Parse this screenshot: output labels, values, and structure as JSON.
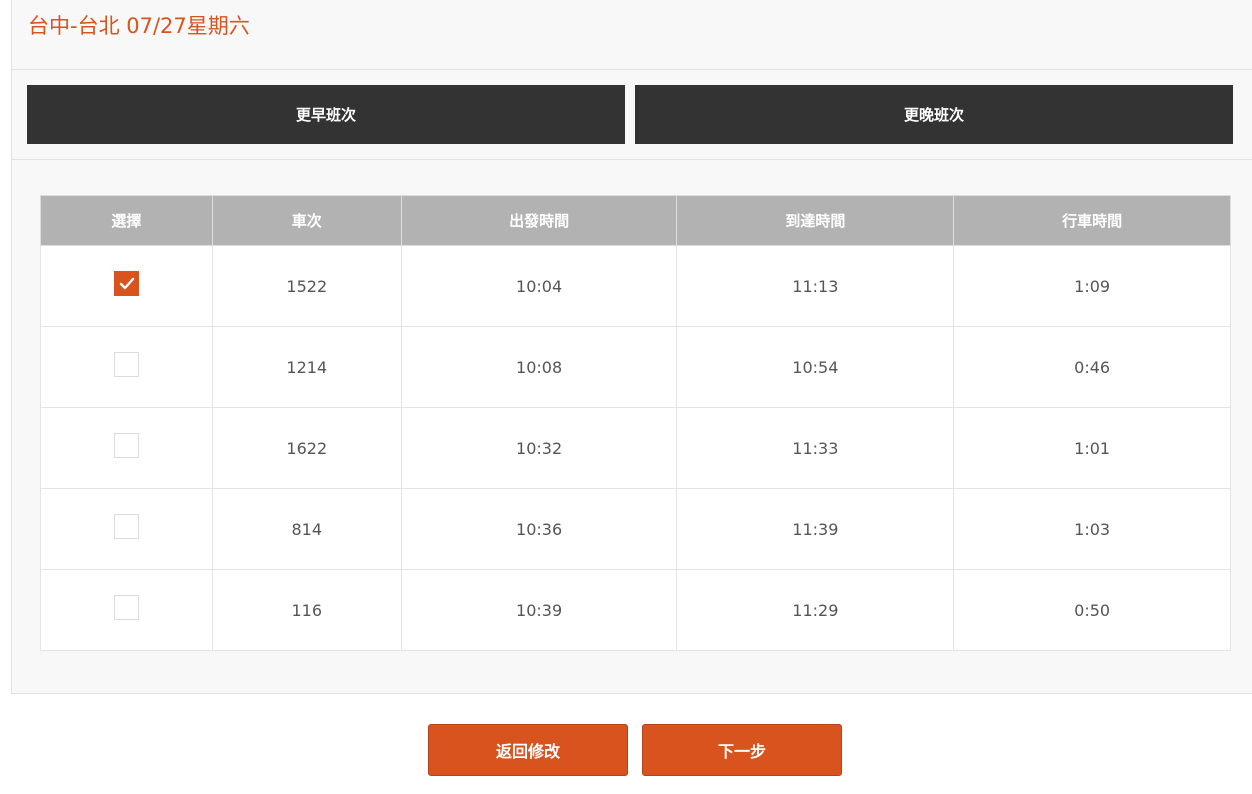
{
  "header": {
    "title": "台中-台北 07/27星期六"
  },
  "nav": {
    "earlier_label": "更早班次",
    "later_label": "更晚班次"
  },
  "table": {
    "columns": [
      "選擇",
      "車次",
      "出發時間",
      "到達時間",
      "行車時間"
    ],
    "rows": [
      {
        "selected": true,
        "train_no": "1522",
        "depart": "10:04",
        "arrive": "11:13",
        "duration": "1:09"
      },
      {
        "selected": false,
        "train_no": "1214",
        "depart": "10:08",
        "arrive": "10:54",
        "duration": "0:46"
      },
      {
        "selected": false,
        "train_no": "1622",
        "depart": "10:32",
        "arrive": "11:33",
        "duration": "1:01"
      },
      {
        "selected": false,
        "train_no": "814",
        "depart": "10:36",
        "arrive": "11:39",
        "duration": "1:03"
      },
      {
        "selected": false,
        "train_no": "116",
        "depart": "10:39",
        "arrive": "11:29",
        "duration": "0:50"
      }
    ]
  },
  "actions": {
    "back_label": "返回修改",
    "next_label": "下一步"
  },
  "colors": {
    "accent": "#d9531e",
    "nav_button": "#333333",
    "table_header": "#b2b2b2"
  },
  "icons": {
    "checkbox_checked": "checkmark-icon"
  }
}
